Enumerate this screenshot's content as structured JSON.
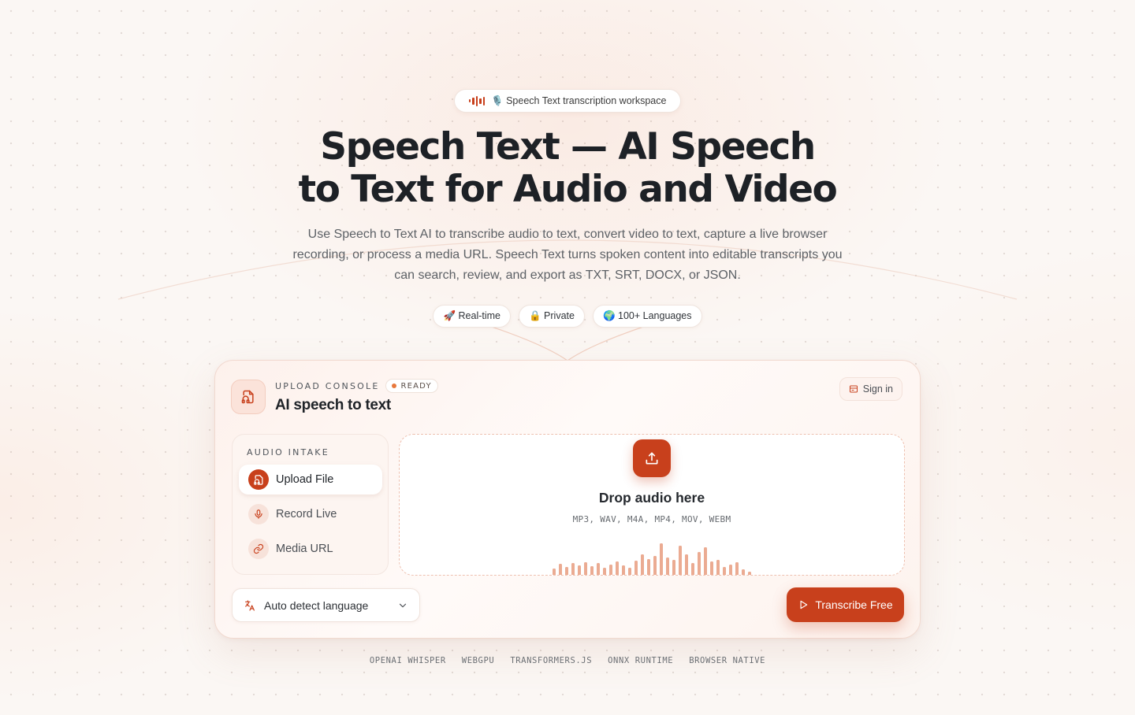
{
  "hero": {
    "badge_text": "🎙️ Speech Text transcription workspace",
    "title_line1": "Speech Text — AI Speech",
    "title_line2": "to Text for Audio and Video",
    "subtitle": "Use Speech to Text AI to transcribe audio to text, convert video to text, capture a live browser recording, or process a media URL. Speech Text turns spoken content into editable transcripts you can search, review, and export as TXT, SRT, DOCX, or JSON.",
    "features": [
      "🚀 Real-time",
      "🔒 Private",
      "🌍 100+ Languages"
    ]
  },
  "console": {
    "eyebrow": "UPLOAD CONSOLE",
    "status": "READY",
    "title": "AI speech to text",
    "signin_label": "Sign in",
    "intake_label": "AUDIO INTAKE",
    "intake_options": [
      {
        "label": "Upload File",
        "icon": "file-audio-icon",
        "active": true
      },
      {
        "label": "Record Live",
        "icon": "microphone-icon",
        "active": false
      },
      {
        "label": "Media URL",
        "icon": "link-icon",
        "active": false
      }
    ],
    "drop_title": "Drop audio here",
    "drop_formats": "MP3, WAV, M4A, MP4, MOV, WEBM",
    "language_value": "Auto detect language",
    "transcribe_label": "Transcribe Free"
  },
  "tech_stack": [
    "OPENAI WHISPER",
    "WEBGPU",
    "TRANSFORMERS.JS",
    "ONNX RUNTIME",
    "BROWSER NATIVE"
  ],
  "colors": {
    "accent": "#c8401c",
    "accent_soft": "#ebab92",
    "status_dot": "#e8783c"
  }
}
